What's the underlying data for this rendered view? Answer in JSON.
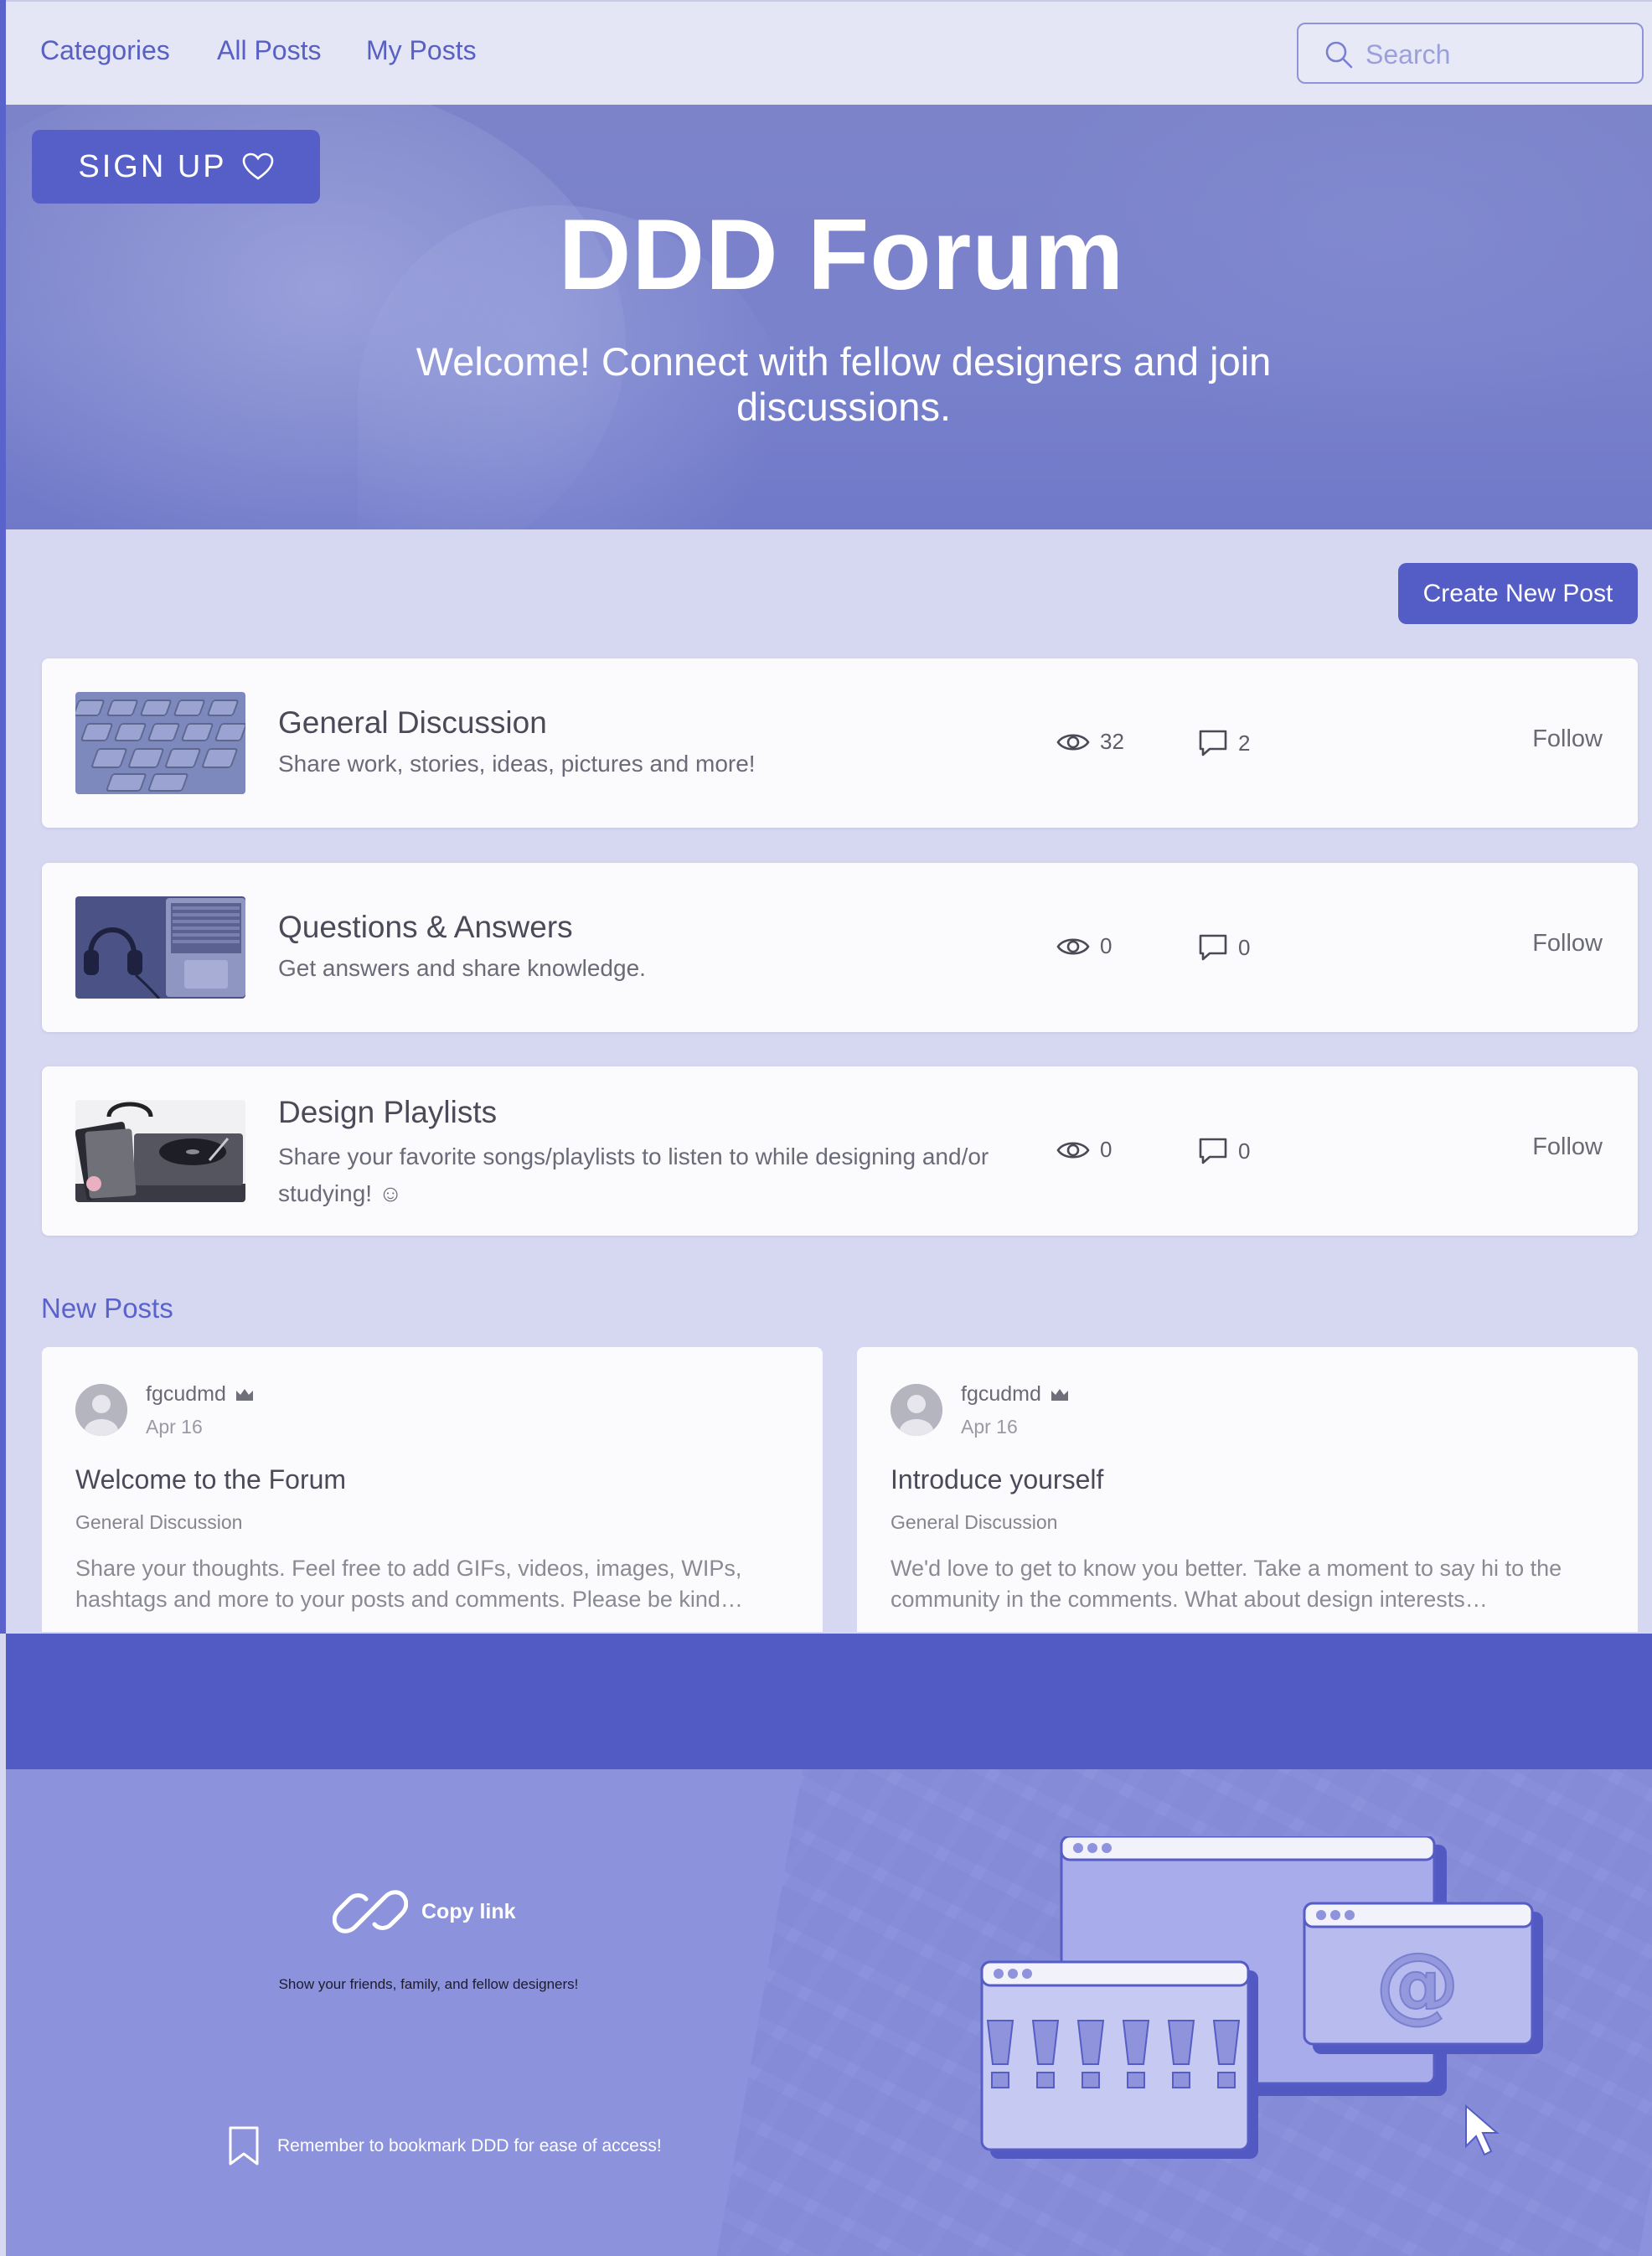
{
  "nav": {
    "links": [
      "Categories",
      "All Posts",
      "My Posts"
    ],
    "search_placeholder": "Search"
  },
  "hero": {
    "signup_label": "SIGN UP",
    "title": "DDD Forum",
    "subtitle": "Welcome! Connect with fellow designers and join discussions."
  },
  "categories": {
    "create_label": "Create New Post",
    "items": [
      {
        "title": "General Discussion",
        "description": "Share work, stories, ideas, pictures and more!",
        "views": "32",
        "comments": "2",
        "follow": "Follow"
      },
      {
        "title": "Questions & Answers",
        "description": "Get answers and share knowledge.",
        "views": "0",
        "comments": "0",
        "follow": "Follow"
      },
      {
        "title": "Design Playlists",
        "description": "Share your favorite songs/playlists to listen to while designing and/or studying! ☺",
        "views": "0",
        "comments": "0",
        "follow": "Follow"
      }
    ]
  },
  "new_posts": {
    "label": "New Posts",
    "posts": [
      {
        "author": "fgcudmd",
        "date": "Apr 16",
        "title": "Welcome to the Forum",
        "category": "General Discussion",
        "excerpt": "Share your thoughts. Feel free to add GIFs, videos, images, WIPs, hashtags and more to your posts and comments. Please be kind…"
      },
      {
        "author": "fgcudmd",
        "date": "Apr 16",
        "title": "Introduce yourself",
        "category": "General Discussion",
        "excerpt": "We'd love to get to know you better. Take a moment to say hi to the community in the comments. What about design interests…"
      }
    ]
  },
  "footer": {
    "copy_link": "Copy link",
    "share_text": "Show your friends, family, and fellow designers!",
    "bookmark_text": "Remember to bookmark DDD for ease of access!"
  },
  "colors": {
    "accent": "#545cc6",
    "page_bg": "#d6d7f1",
    "footer_bg": "#8c92db",
    "band": "#525bc4"
  }
}
